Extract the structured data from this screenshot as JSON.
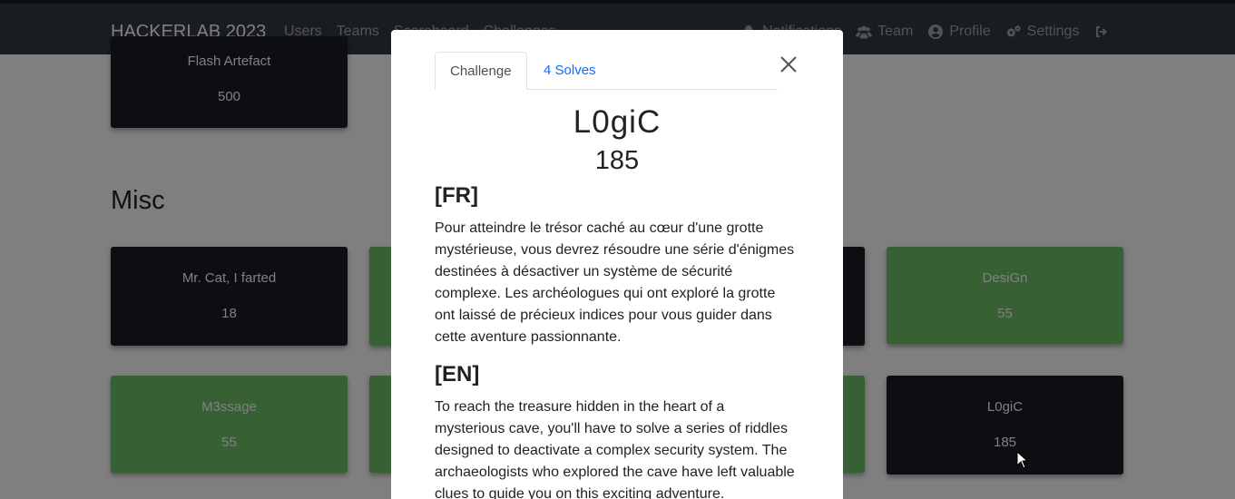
{
  "navbar": {
    "brand": "HACKERLAB 2023",
    "left_links": [
      "Users",
      "Teams",
      "Scoreboard",
      "Challenges"
    ],
    "right_links": [
      {
        "label": "Notifications",
        "icon": "bell-icon"
      },
      {
        "label": "Team",
        "icon": "users-icon"
      },
      {
        "label": "Profile",
        "icon": "user-circle-icon"
      },
      {
        "label": "Settings",
        "icon": "gears-icon"
      },
      {
        "label": "",
        "icon": "logout-icon"
      }
    ]
  },
  "page": {
    "top_card": {
      "name": "Flash Artefact",
      "value": "500"
    },
    "section_title": "Misc",
    "cards": [
      {
        "name": "Mr. Cat, I farted",
        "value": "18",
        "style": "dark"
      },
      {
        "name": "DesiGn",
        "value": "55",
        "style": "green"
      },
      {
        "name": "M3ssage",
        "value": "55",
        "style": "green"
      },
      {
        "name": "L0giC",
        "value": "185",
        "style": "dark"
      }
    ]
  },
  "modal": {
    "tabs": [
      "Challenge",
      "4 Solves"
    ],
    "challenge_name": "L0giC",
    "challenge_value": "185",
    "fr_heading": "[FR]",
    "fr_text": "Pour atteindre le trésor caché au cœur d'une grotte mystérieuse, vous devrez résoudre une série d'énigmes destinées à désactiver un système de sécurité complexe. Les archéologues qui ont exploré la grotte ont laissé de précieux indices pour vous guider dans cette aventure passionnante.",
    "en_heading": "[EN]",
    "en_text": "To reach the treasure hidden in the heart of a mysterious cave, you'll have to solve a series of riddles designed to deactivate a complex security system. The archaeologists who explored the cave have left valuable clues to guide you on this exciting adventure."
  },
  "colors": {
    "navbar": "#343a40",
    "card_dark": "#1a1c22",
    "card_green": "#6fc36a",
    "link": "#0d6efd"
  }
}
